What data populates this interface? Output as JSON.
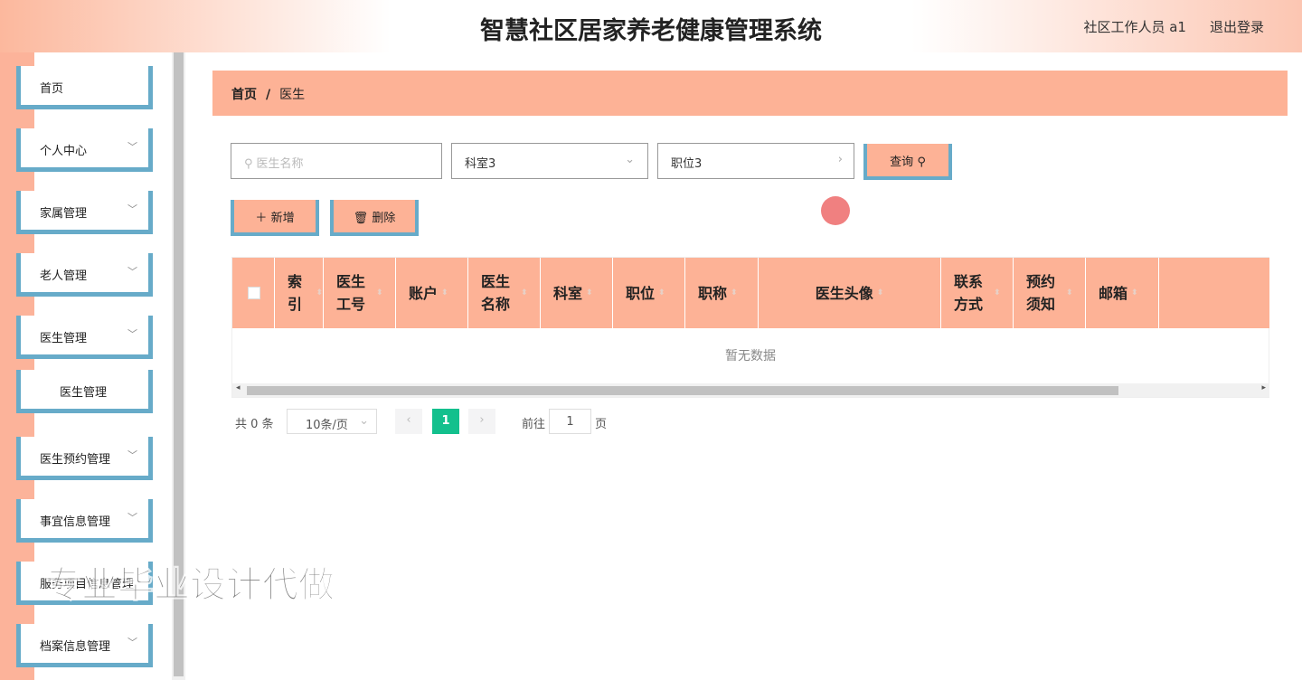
{
  "header": {
    "title": "智慧社区居家养老健康管理系统",
    "user": "社区工作人员 a1",
    "logout": "退出登录"
  },
  "sidebar": {
    "items": [
      {
        "label": "首页",
        "expand": false
      },
      {
        "label": "个人中心",
        "expand": true
      },
      {
        "label": "家属管理",
        "expand": true
      },
      {
        "label": "老人管理",
        "expand": true
      },
      {
        "label": "医生管理",
        "expand": true
      },
      {
        "label": "医生管理",
        "sub": true
      },
      {
        "label": "医生预约管理",
        "expand": true
      },
      {
        "label": "事宜信息管理",
        "expand": true
      },
      {
        "label": "服务项目信息管理",
        "expand": false
      },
      {
        "label": "档案信息管理",
        "expand": true
      }
    ]
  },
  "breadcrumb": {
    "home": "首页",
    "sep": "/",
    "current": "医生"
  },
  "search": {
    "name_placeholder": "医生名称",
    "dept_value": "科室3",
    "position_value": "职位3",
    "query": "查询"
  },
  "actions": {
    "add": "新增",
    "delete": "删除"
  },
  "table": {
    "columns": [
      "索引",
      "医生工号",
      "账户",
      "医生名称",
      "科室",
      "职位",
      "职称",
      "医生头像",
      "联系方式",
      "预约须知",
      "邮箱"
    ],
    "empty": "暂无数据"
  },
  "pagination": {
    "total": "共 0 条",
    "page_size": "10条/页",
    "current": "1",
    "goto": "前往",
    "goto_value": "1",
    "page_suffix": "页"
  },
  "watermark": "专业毕业设计代做"
}
